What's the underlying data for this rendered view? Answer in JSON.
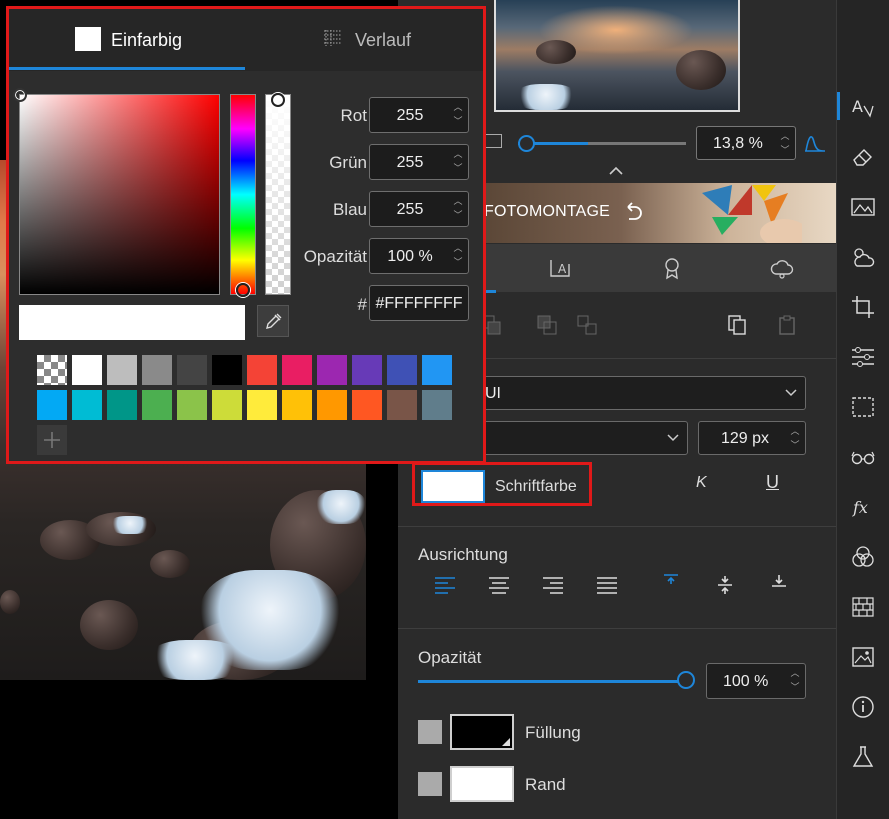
{
  "picker": {
    "tab_solid": "Einfarbig",
    "tab_gradient": "Verlauf",
    "fields": [
      {
        "label": "Rot",
        "value": "255"
      },
      {
        "label": "Grün",
        "value": "255"
      },
      {
        "label": "Blau",
        "value": "255"
      },
      {
        "label": "Opazität",
        "value": "100 %"
      }
    ],
    "hex_label": "#",
    "hex_value": "#FFFFFFFF",
    "swatch_colors": [
      "transparent",
      "#ffffff",
      "#bdbdbd",
      "#8a8a8a",
      "#444444",
      "#000000",
      "#f44336",
      "#e91e63",
      "#9c27b0",
      "#673ab7",
      "#3f51b5",
      "#2196f3",
      "#03a9f4",
      "#00bcd4",
      "#009688",
      "#4caf50",
      "#8bc34a",
      "#cddc39",
      "#ffeb3b",
      "#ffc107",
      "#ff9800",
      "#ff5722",
      "#795548",
      "#607d8b"
    ]
  },
  "panel": {
    "zoom_value": "13,8 %",
    "banner_label": "FOTOMONTAGE",
    "font_partial": "UI",
    "font_size": "129 px",
    "font_color_label": "Schriftfarbe",
    "italic_label": "K",
    "underline_label": "U",
    "alignment_title": "Ausrichtung",
    "opacity_title": "Opazität",
    "opacity_value": "100 %",
    "opacity_level": 1.0,
    "fill_label": "Füllung",
    "stroke_label": "Rand"
  },
  "colors": {
    "accent": "#1e86d9",
    "highlight": "#e01919"
  }
}
